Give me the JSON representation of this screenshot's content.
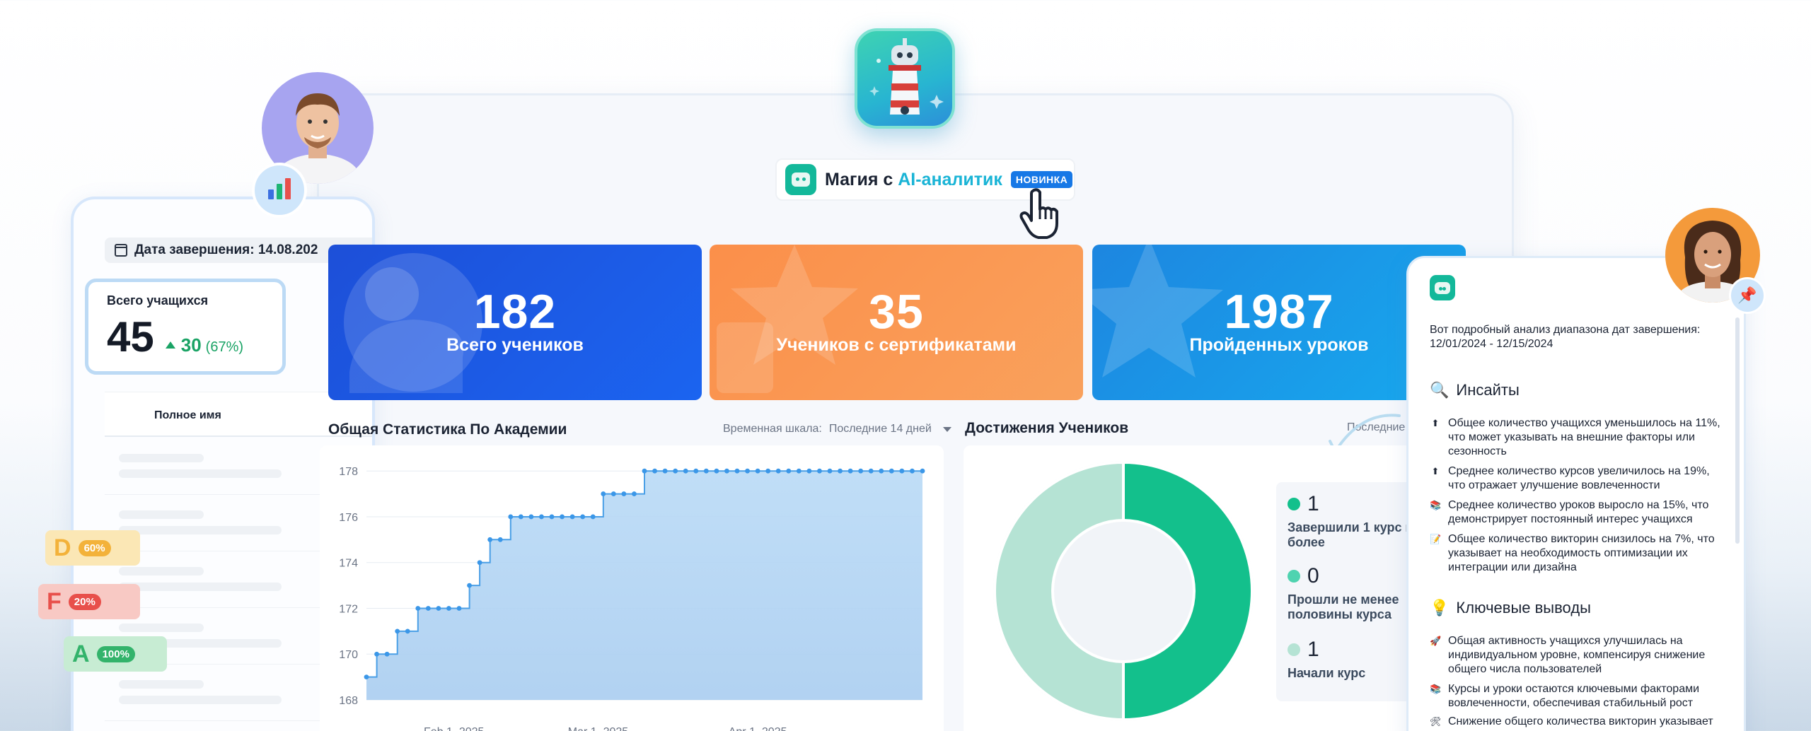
{
  "left_panel": {
    "date_label": "Дата завершения: 14.08.202",
    "total_card": {
      "label": "Всего учащихся",
      "value": "45",
      "delta": "30",
      "delta_pct": "(67%)"
    },
    "table_header": "Полное имя"
  },
  "ai_chip": {
    "prefix": "Магия с",
    "accent": "AI-аналитик",
    "badge": "НОВИНКА"
  },
  "stat_cards": [
    {
      "value": "182",
      "label": "Всего учеников"
    },
    {
      "value": "35",
      "label": "Учеников с сертификатами"
    },
    {
      "value": "1987",
      "label": "Пройденных уроков"
    }
  ],
  "academy": {
    "title": "Общая Статистика По Академии",
    "timescale_label": "Временная шкала:",
    "timescale_value": "Последние 14 дней"
  },
  "achievements": {
    "title": "Достижения Учеников",
    "period": "Последние",
    "legend": [
      {
        "value": "1",
        "label": "Завершили 1 курс и более",
        "color": "#13c08c"
      },
      {
        "value": "0",
        "label": "Прошли не менее половины курса",
        "color": "#4fd3b0"
      },
      {
        "value": "1",
        "label": "Начали курс",
        "color": "#b5e3d4"
      }
    ]
  },
  "chart_data": {
    "type": "area",
    "title": "Общая Статистика По Академии",
    "x_tick_labels": [
      "Feb 1, 2025",
      "Mar 1, 2025",
      "Apr 1, 2025"
    ],
    "y_ticks": [
      168,
      170,
      172,
      174,
      176,
      178
    ],
    "ylim": [
      168,
      178.5
    ],
    "grid": true,
    "series": [
      {
        "x": [
          "2025-01-15",
          "2025-01-17",
          "2025-01-19",
          "2025-01-21",
          "2025-01-23",
          "2025-01-25",
          "2025-01-27",
          "2025-01-29",
          "2025-01-31",
          "2025-02-02",
          "2025-02-04",
          "2025-02-06",
          "2025-02-08",
          "2025-02-10",
          "2025-02-12",
          "2025-02-14",
          "2025-02-16",
          "2025-02-18",
          "2025-02-20",
          "2025-02-22",
          "2025-02-24",
          "2025-02-26",
          "2025-02-28",
          "2025-03-02",
          "2025-03-04",
          "2025-03-06",
          "2025-03-08",
          "2025-03-10",
          "2025-03-12",
          "2025-03-14",
          "2025-03-16",
          "2025-03-18",
          "2025-03-20",
          "2025-03-22",
          "2025-03-24",
          "2025-03-26",
          "2025-03-28",
          "2025-03-30",
          "2025-04-01",
          "2025-04-03",
          "2025-04-05",
          "2025-04-07",
          "2025-04-09",
          "2025-04-11",
          "2025-04-13",
          "2025-04-15",
          "2025-04-17",
          "2025-04-19",
          "2025-04-21",
          "2025-04-23",
          "2025-04-25",
          "2025-04-27",
          "2025-04-29",
          "2025-05-01",
          "2025-05-03"
        ],
        "values": [
          169,
          170,
          170,
          171,
          171,
          172,
          172,
          172,
          172,
          172,
          173,
          174,
          175,
          175,
          176,
          176,
          176,
          176,
          176,
          176,
          176,
          176,
          176,
          177,
          177,
          177,
          177,
          178,
          178,
          178,
          178,
          178,
          178,
          178,
          178,
          178,
          178,
          178,
          178,
          178,
          178,
          178,
          178,
          178,
          178,
          178,
          178,
          178,
          178,
          178,
          178,
          178,
          178,
          178,
          178
        ]
      }
    ],
    "x_range": [
      "2025-01-15",
      "2025-05-03"
    ],
    "tick_dates": [
      "2025-02-01",
      "2025-03-01",
      "2025-04-01"
    ]
  },
  "donut": {
    "completed": 1,
    "half": 0,
    "started": 1
  },
  "insights": {
    "intro": "Вот подробный анализ диапазона дат завершения: 12/01/2024 - 12/15/2024",
    "insights_title": "Инсайты",
    "items": [
      {
        "icon": "⬆",
        "text": "Общее количество учащихся уменьшилось на 11%, что может указывать на внешние факторы или сезонность"
      },
      {
        "icon": "⬆",
        "text": "Среднее количество курсов увеличилось на 19%, что отражает улучшение вовлеченности"
      },
      {
        "icon": "📚",
        "text": "Среднее количество уроков выросло на 15%, что демонстрирует постоянный интерес учащихся"
      },
      {
        "icon": "📝",
        "text": "Общее количество викторин снизилось на 7%, что указывает на необходимость оптимизации их интеграции или дизайна"
      }
    ],
    "conclusions_title": "Ключевые выводы",
    "conclusions": [
      {
        "icon": "🚀",
        "text": "Общая активность учащихся улучшилась на индивидуальном уровне, компенсируя снижение общего числа пользователей"
      },
      {
        "icon": "📚",
        "text": "Курсы и уроки остаются ключевыми факторами вовлеченности, обеспечивая стабильный рост"
      },
      {
        "icon": "🛠",
        "text": "Снижение общего количества викторин указывает"
      }
    ]
  },
  "grades": [
    {
      "letter": "D",
      "pct": "60%",
      "color": "#f3b23a",
      "bg": "#fbe7b5"
    },
    {
      "letter": "F",
      "pct": "20%",
      "color": "#e8504b",
      "bg": "#f8c9c4"
    },
    {
      "letter": "A",
      "pct": "100%",
      "color": "#33b36b",
      "bg": "#c7ecd3"
    }
  ]
}
